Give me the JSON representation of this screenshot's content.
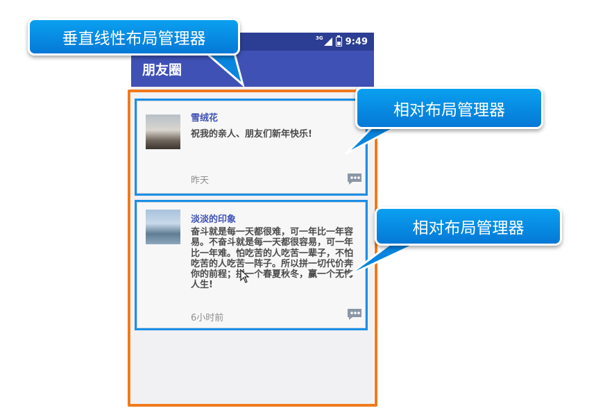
{
  "status": {
    "network": "3G",
    "time": "9:49"
  },
  "app": {
    "title": "朋友圈"
  },
  "posts": [
    {
      "name": "雪绒花",
      "content": "祝我的亲人、朋友们新年快乐!",
      "time": "昨天"
    },
    {
      "name": "淡淡的印象",
      "content": "奋斗就是每一天都很难，可一年比一年容易。不奋斗就是每一天都很容易，可一年比一年难。怕吃苦的人吃苦一辈子，不怕吃苦的人吃苦一阵子。所以拼一切代价奔你的前程；拼一个春夏秋冬，赢一个无悔人生!",
      "time": "6小时前"
    }
  ],
  "callouts": {
    "vertical_linear": "垂直线性布局管理器",
    "relative_1": "相对布局管理器",
    "relative_2": "相对布局管理器"
  },
  "icons": {
    "comment": "comment-icon",
    "cursor": "mouse-cursor-icon"
  },
  "colors": {
    "primary": "#3f51b5",
    "primary_dark": "#2c3e93",
    "outline_orange": "#f07a1c",
    "outline_blue": "#1a8fe6",
    "callout_blue": "#0a8ee8"
  }
}
